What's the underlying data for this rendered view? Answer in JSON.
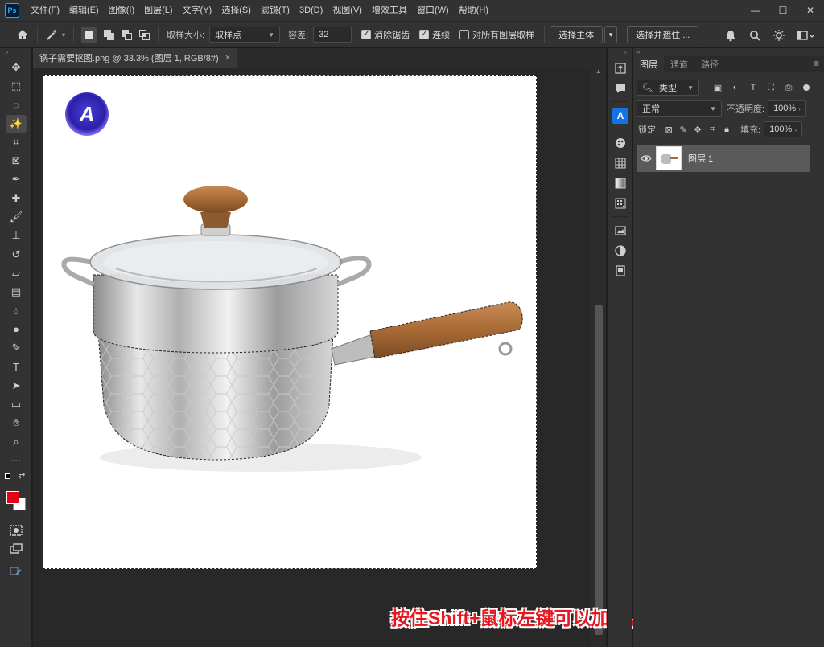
{
  "app": {
    "logo": "Ps"
  },
  "menu": [
    "文件(F)",
    "编辑(E)",
    "图像(I)",
    "图层(L)",
    "文字(Y)",
    "选择(S)",
    "滤镜(T)",
    "3D(D)",
    "视图(V)",
    "增效工具",
    "窗口(W)",
    "帮助(H)"
  ],
  "window_buttons": [
    "—",
    "☐",
    "✕"
  ],
  "options": {
    "sample_size_label": "取样大小:",
    "sample_size_value": "取样点",
    "tolerance_label": "容差:",
    "tolerance_value": "32",
    "antialias_label": "消除锯齿",
    "antialias_checked": true,
    "contiguous_label": "连续",
    "contiguous_checked": true,
    "all_layers_label": "对所有图层取样",
    "all_layers_checked": false,
    "select_subject_label": "选择主体",
    "select_mask_label": "选择并遮住 ..."
  },
  "document": {
    "tab_title": "锅子需要抠图.png @ 33.3% (图层 1, RGB/8#)",
    "tab_close": "×",
    "logo_letter": "A"
  },
  "overlay_caption": "按住Shift+鼠标左键可以加选，Alt可以减选",
  "colors": {
    "foreground": "#e60012",
    "background": "#ffffff",
    "caption": "#e8161e"
  },
  "tools": [
    "move-icon",
    "marquee-icon",
    "lasso-icon",
    "magic-wand-icon",
    "crop-icon",
    "frame-icon",
    "eyedropper-icon",
    "healing-icon",
    "brush-icon",
    "stamp-icon",
    "history-brush-icon",
    "eraser-icon",
    "gradient-icon",
    "blur-icon",
    "dodge-icon",
    "pen-icon",
    "type-icon",
    "path-select-icon",
    "rectangle-icon",
    "hand-icon",
    "zoom-icon",
    "more-tools-icon"
  ],
  "layers_panel": {
    "tabs": [
      "图层",
      "通道",
      "路径"
    ],
    "filter_label": "类型",
    "blend_mode": "正常",
    "opacity_label": "不透明度:",
    "opacity_value": "100%",
    "lock_label": "锁定:",
    "fill_label": "填充:",
    "fill_value": "100%",
    "layers": [
      {
        "name": "图层 1",
        "visible": true
      }
    ]
  }
}
